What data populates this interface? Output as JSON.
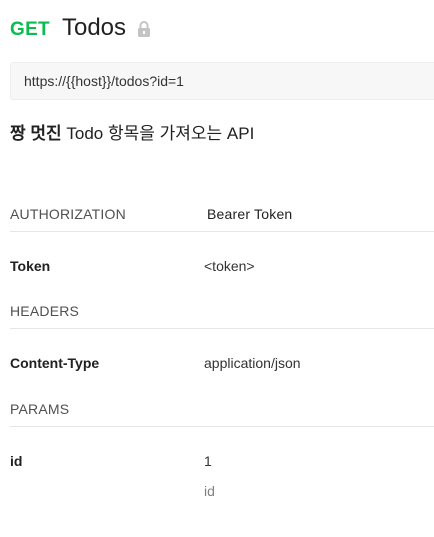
{
  "request": {
    "method": "GET",
    "name": "Todos",
    "url": "https://{{host}}/todos?id=1",
    "description_bold": "짱 멋진",
    "description_rest": "Todo 항목을 가져오는 API",
    "icon": "lock-icon"
  },
  "authorization": {
    "heading": "AUTHORIZATION",
    "type": "Bearer Token",
    "key": "Token",
    "value": "<token>"
  },
  "headers": {
    "heading": "HEADERS",
    "items": [
      {
        "key": "Content-Type",
        "value": "application/json"
      }
    ]
  },
  "params": {
    "heading": "PARAMS",
    "items": [
      {
        "key": "id",
        "value": "1",
        "description": "id"
      }
    ]
  },
  "colors": {
    "method_get": "#0cbb52",
    "lock": "#c4c4c4"
  }
}
